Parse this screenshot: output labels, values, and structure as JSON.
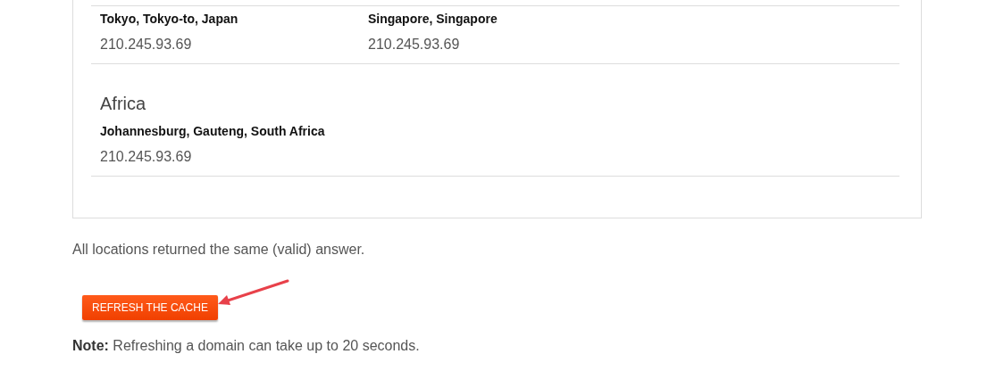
{
  "regions": [
    {
      "locations": [
        {
          "name": "Tokyo, Tokyo-to, Japan",
          "ip": "210.245.93.69"
        },
        {
          "name": "Singapore, Singapore",
          "ip": "210.245.93.69"
        }
      ]
    },
    {
      "heading": "Africa",
      "locations": [
        {
          "name": "Johannesburg, Gauteng, South Africa",
          "ip": "210.245.93.69"
        }
      ]
    }
  ],
  "summary": "All locations returned the same (valid) answer.",
  "refresh_button": {
    "label": "REFRESH THE CACHE"
  },
  "note": "**Note:** Refreshing a domain can take up to 20 seconds."
}
